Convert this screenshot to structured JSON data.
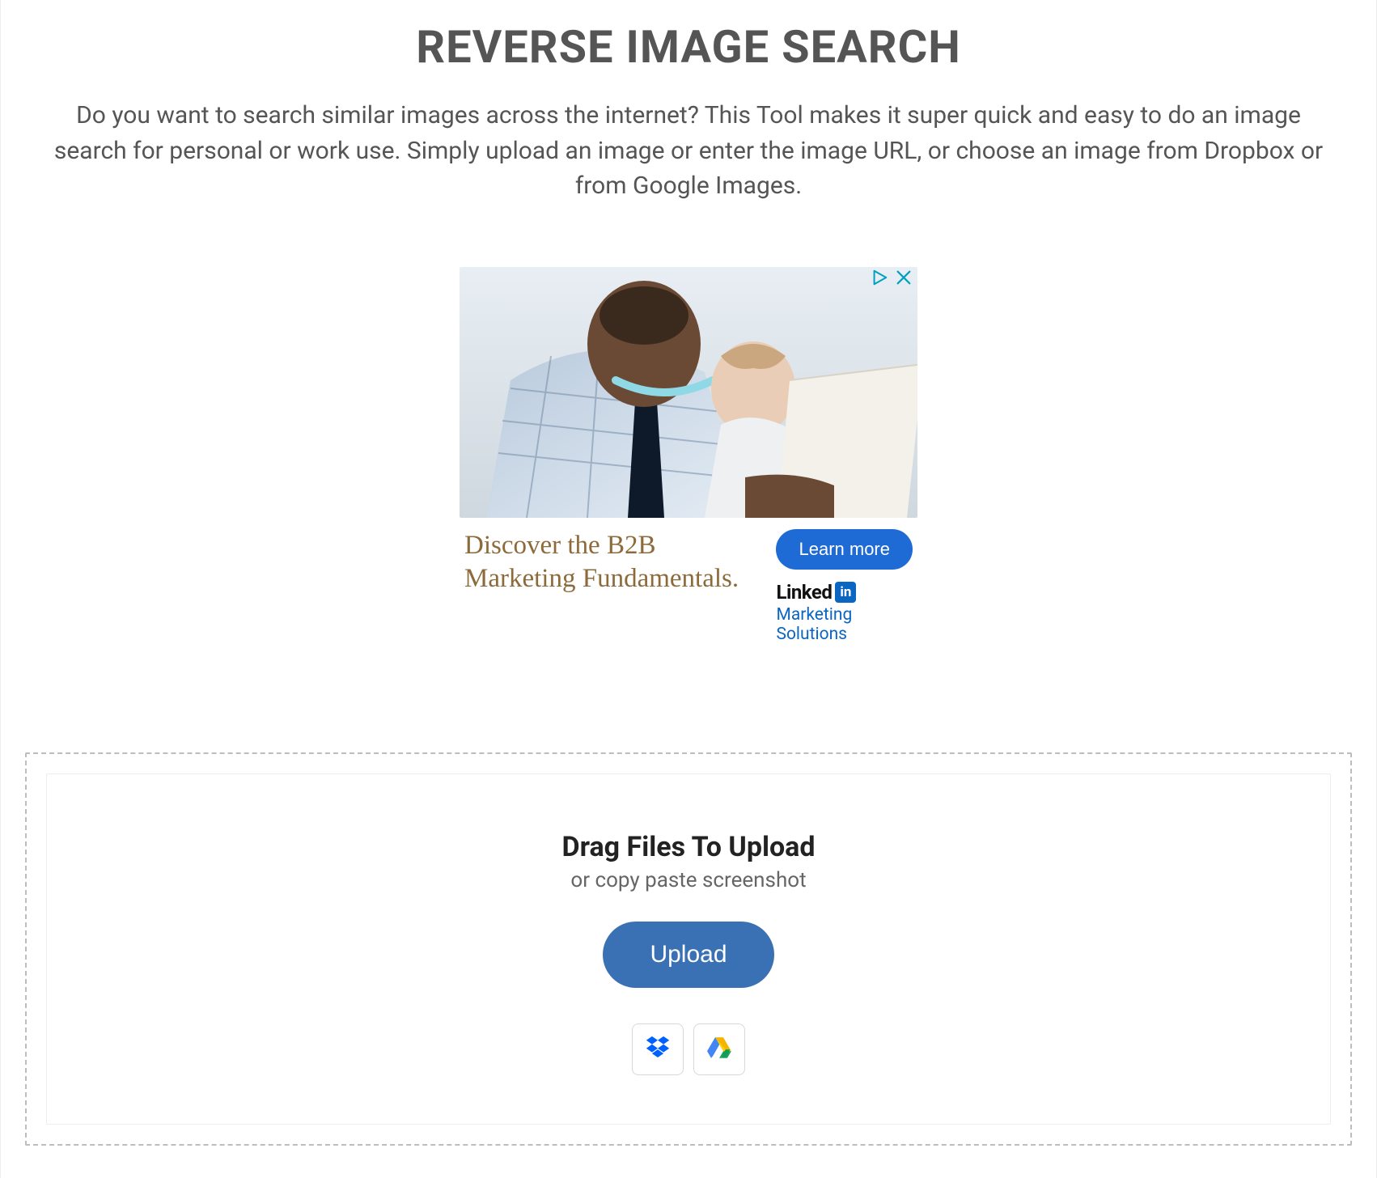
{
  "header": {
    "title": "REVERSE IMAGE SEARCH",
    "description": "Do you want to search similar images across the internet? This Tool makes it super quick and easy to do an image search for personal or work use. Simply upload an image or enter the image URL, or choose an image from Dropbox or from Google Images."
  },
  "ad": {
    "headline": "Discover the B2B Marketing Fundamentals.",
    "cta_label": "Learn more",
    "brand_main": "Linked",
    "brand_badge": "in",
    "brand_sub": "Marketing Solutions"
  },
  "upload": {
    "drag_title": "Drag Files To Upload",
    "drag_sub": "or copy paste screenshot",
    "button_label": "Upload"
  }
}
